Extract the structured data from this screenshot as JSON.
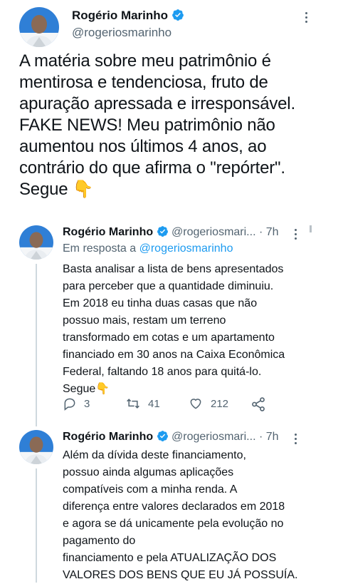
{
  "main_tweet": {
    "name": "Rogério Marinho",
    "handle": "@rogeriosmarinho",
    "text": "A matéria sobre meu patrimônio é\nmentirosa e tendenciosa, fruto de\napuração apressada e irresponsável.\nFAKE NEWS! Meu patrimônio não\naumentou nos últimos 4 anos, ao\ncontrário do que afirma o \"repórter\".\nSegue 👇"
  },
  "reply1": {
    "name": "Rogério Marinho",
    "handle_time": "@rogeriosmari... · 7h",
    "reply_to_prefix": "Em resposta a",
    "reply_to_handle": "@rogeriosmarinho",
    "text": "Basta analisar a lista de bens apresentados\npara perceber que a quantidade diminuiu.\nEm 2018 eu tinha duas casas que não\npossuo mais, restam um terreno\ntransformado em cotas e um apartamento\nfinanciado em 30 anos na Caixa Econômica\nFederal, faltando 18 anos para quitá-lo.\nSegue👇",
    "replies": "3",
    "retweets": "41",
    "likes": "212"
  },
  "reply2": {
    "name": "Rogério Marinho",
    "handle_time": "@rogeriosmari... · 7h",
    "text": "Além da dívida deste financiamento,\npossuo ainda algumas aplicações\ncompatíveis com a minha renda. A\ndiferença entre valores declarados em 2018\ne agora se dá unicamente pela evolução no\npagamento do\nfinanciamento e pela ATUALIZAÇÃO DOS\nVALORES DOS BENS QUE EU JÁ POSSUÍA."
  },
  "colors": {
    "accent": "#1d9bf0",
    "muted": "#536471",
    "text": "#0f1419"
  }
}
